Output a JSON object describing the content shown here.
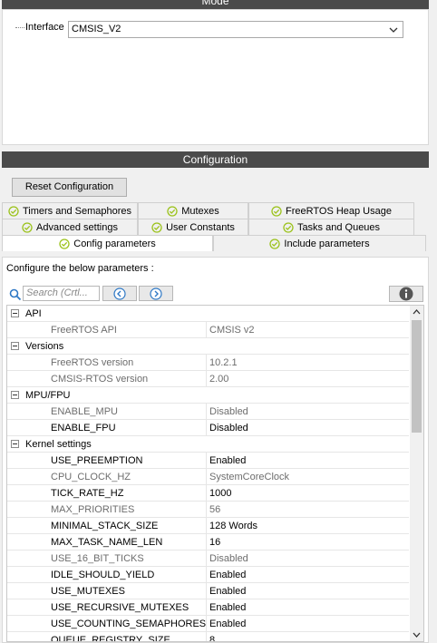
{
  "mode": {
    "title": "Mode",
    "interface_label": "Interface",
    "interface_value": "CMSIS_V2"
  },
  "config": {
    "title": "Configuration",
    "reset_label": "Reset Configuration",
    "tabs_row1": [
      "Timers and Semaphores",
      "Mutexes",
      "FreeRTOS Heap Usage"
    ],
    "tabs_row2": [
      "Advanced settings",
      "User Constants",
      "Tasks and Queues"
    ],
    "tabs_row3": [
      "Config parameters",
      "Include parameters"
    ],
    "configure_label": "Configure the below parameters :",
    "search_placeholder": "Search (Crtl...",
    "groups": [
      {
        "name": "API",
        "params": [
          {
            "name": "FreeRTOS API",
            "value": "CMSIS v2",
            "enabled": false
          }
        ]
      },
      {
        "name": "Versions",
        "params": [
          {
            "name": "FreeRTOS version",
            "value": "10.2.1",
            "enabled": false
          },
          {
            "name": "CMSIS-RTOS version",
            "value": "2.00",
            "enabled": false
          }
        ]
      },
      {
        "name": "MPU/FPU",
        "params": [
          {
            "name": "ENABLE_MPU",
            "value": "Disabled",
            "enabled": false
          },
          {
            "name": "ENABLE_FPU",
            "value": "Disabled",
            "enabled": true
          }
        ]
      },
      {
        "name": "Kernel settings",
        "params": [
          {
            "name": "USE_PREEMPTION",
            "value": "Enabled",
            "enabled": true
          },
          {
            "name": "CPU_CLOCK_HZ",
            "value": "SystemCoreClock",
            "enabled": false
          },
          {
            "name": "TICK_RATE_HZ",
            "value": "1000",
            "enabled": true
          },
          {
            "name": "MAX_PRIORITIES",
            "value": "56",
            "enabled": false
          },
          {
            "name": "MINIMAL_STACK_SIZE",
            "value": "128 Words",
            "enabled": true
          },
          {
            "name": "MAX_TASK_NAME_LEN",
            "value": "16",
            "enabled": true
          },
          {
            "name": "USE_16_BIT_TICKS",
            "value": "Disabled",
            "enabled": false
          },
          {
            "name": "IDLE_SHOULD_YIELD",
            "value": "Enabled",
            "enabled": true
          },
          {
            "name": "USE_MUTEXES",
            "value": "Enabled",
            "enabled": true
          },
          {
            "name": "USE_RECURSIVE_MUTEXES",
            "value": "Enabled",
            "enabled": true
          },
          {
            "name": "USE_COUNTING_SEMAPHORES",
            "value": "Enabled",
            "enabled": true
          },
          {
            "name": "QUEUE_REGISTRY_SIZE",
            "value": "8",
            "enabled": true
          }
        ]
      }
    ]
  },
  "icons": {
    "check": "check-circle-icon",
    "search": "search-icon",
    "prev": "arrow-left-icon",
    "next": "arrow-right-icon",
    "info": "info-icon"
  },
  "colors": {
    "header_bg": "#4b4b4b",
    "check_green": "#9bc21b",
    "nav_blue": "#2e78c5"
  }
}
